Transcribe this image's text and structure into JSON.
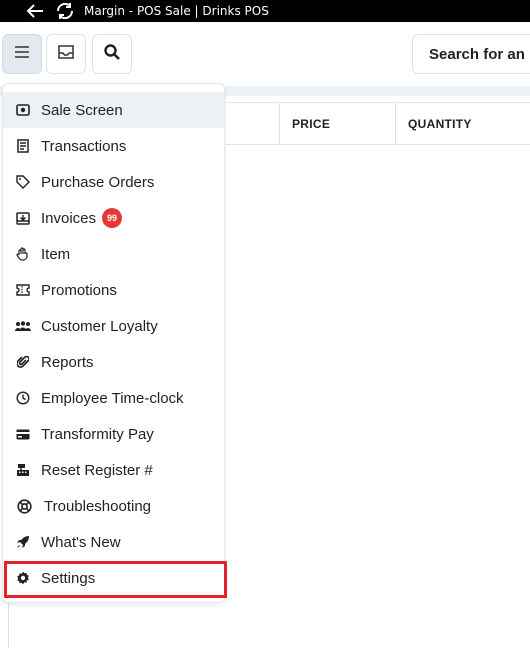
{
  "window": {
    "title": "Margin - POS Sale | Drinks POS"
  },
  "toolbar": {
    "search_placeholder": "Search for an"
  },
  "table": {
    "columns": [
      "PRICE",
      "QUANTITY"
    ]
  },
  "menu": {
    "items": [
      {
        "label": "Sale Screen",
        "icon": "sale-screen-icon"
      },
      {
        "label": "Transactions",
        "icon": "receipt-icon"
      },
      {
        "label": "Purchase Orders",
        "icon": "tag-icon"
      },
      {
        "label": "Invoices",
        "icon": "inbox-icon",
        "badge": "99"
      },
      {
        "label": "Item",
        "icon": "hand-icon"
      },
      {
        "label": "Promotions",
        "icon": "ticket-icon"
      },
      {
        "label": "Customer Loyalty",
        "icon": "users-icon"
      },
      {
        "label": "Reports",
        "icon": "paperclip-icon"
      },
      {
        "label": "Employee Time-clock",
        "icon": "clock-icon"
      },
      {
        "label": "Transformity Pay",
        "icon": "credit-card-icon"
      },
      {
        "label": "Reset Register #",
        "icon": "register-icon"
      },
      {
        "label": "Troubleshooting",
        "icon": "lifebuoy-icon"
      },
      {
        "label": "What's New",
        "icon": "rocket-icon"
      },
      {
        "label": "Settings",
        "icon": "gear-icon"
      }
    ]
  },
  "colors": {
    "highlight": "#e1242c",
    "badge": "#e53935"
  }
}
